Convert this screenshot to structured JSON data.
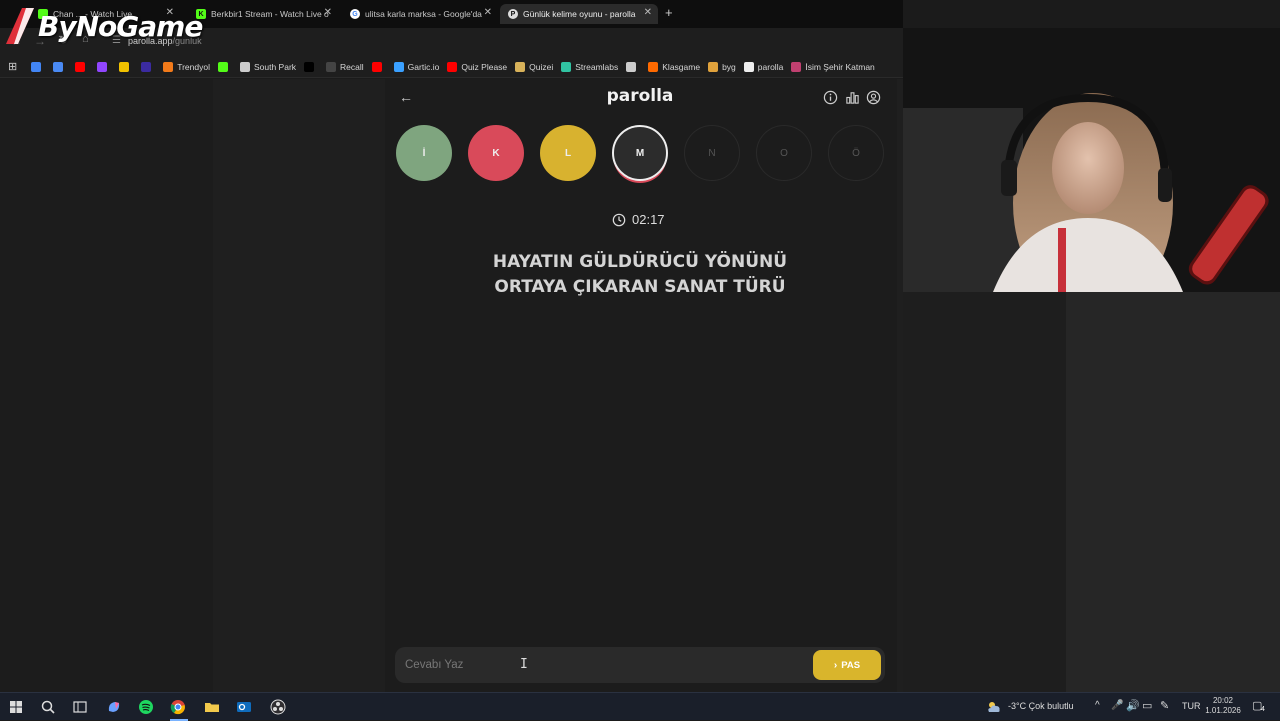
{
  "browser": {
    "tabs": [
      {
        "label": "Chan ... - Watch Live",
        "favicon_color": "#53fc18",
        "active": false
      },
      {
        "label": "Berkbir1 Stream - Watch Live o",
        "favicon_color": "#53fc18",
        "active": false
      },
      {
        "label": "ulitsa karla marksa - Google'da",
        "favicon_color": "#ffffff",
        "active": false
      },
      {
        "label": "Günlük kelime oyunu - parolla",
        "favicon_color": "#dddddd",
        "active": true
      }
    ],
    "new_tab": "+",
    "url_host": "parolla.app",
    "url_path": "/gunluk",
    "bookmarks": [
      {
        "label": "",
        "icon": "google-icon",
        "color": "#4285f4"
      },
      {
        "label": "",
        "icon": "translate-icon",
        "color": "#4a8af4"
      },
      {
        "label": "",
        "icon": "youtube-icon",
        "color": "#ff0000"
      },
      {
        "label": "",
        "icon": "twitch-icon",
        "color": "#9146ff"
      },
      {
        "label": "",
        "icon": "folder-icon",
        "color": "#f2c200"
      },
      {
        "label": "",
        "icon": "app-icon",
        "color": "#3b2ba0"
      },
      {
        "label": "Trendyol",
        "icon": "trendyol-icon",
        "color": "#f27a1a"
      },
      {
        "label": "",
        "icon": "kick-icon",
        "color": "#53fc18"
      },
      {
        "label": "South Park",
        "icon": "globe-icon",
        "color": "#cccccc"
      },
      {
        "label": "",
        "icon": "x-icon",
        "color": "#000000"
      },
      {
        "label": "Recall",
        "icon": "recall-icon",
        "color": "#444444"
      },
      {
        "label": "",
        "icon": "youtube-icon",
        "color": "#ff0000"
      },
      {
        "label": "Gartic.io",
        "icon": "gartic-icon",
        "color": "#3aa0ff"
      },
      {
        "label": "Quiz Please",
        "icon": "youtube-icon",
        "color": "#ff0000"
      },
      {
        "label": "Quizei",
        "icon": "quizei-icon",
        "color": "#d8b25a"
      },
      {
        "label": "Streamlabs",
        "icon": "streamlabs-icon",
        "color": "#31c3a2"
      },
      {
        "label": "",
        "icon": "globe-icon",
        "color": "#cccccc"
      },
      {
        "label": "Klasgame",
        "icon": "klasgame-icon",
        "color": "#ff6a00"
      },
      {
        "label": "byg",
        "icon": "byg-icon",
        "color": "#e0a23c"
      },
      {
        "label": "parolla",
        "icon": "parolla-icon",
        "color": "#eeeeee"
      },
      {
        "label": "İsim Şehir Katman",
        "icon": "isim-icon",
        "color": "#c04070"
      }
    ]
  },
  "logo": {
    "text": "ByNoGame"
  },
  "app": {
    "title": "parolla",
    "letters": [
      {
        "char": "İ",
        "state": "correct",
        "bg": "#7fa57f",
        "fg": "#eeeeee"
      },
      {
        "char": "K",
        "state": "wrong",
        "bg": "#d94a5a",
        "fg": "#eeeeee"
      },
      {
        "char": "L",
        "state": "pass",
        "bg": "#d8b22f",
        "fg": "#eeeeee"
      },
      {
        "char": "M",
        "state": "current",
        "bg": "#2c2c2c",
        "fg": "#eeeeee"
      },
      {
        "char": "N",
        "state": "future",
        "bg": "",
        "fg": "#555555"
      },
      {
        "char": "O",
        "state": "future",
        "bg": "",
        "fg": "#555555"
      },
      {
        "char": "Ö",
        "state": "future",
        "bg": "",
        "fg": "#555555"
      }
    ],
    "timer": "02:17",
    "question_line1": "HAYATIN GÜLDÜRÜCÜ YÖNÜNÜ",
    "question_line2": "ORTAYA ÇIKARAN SANAT TÜRÜ",
    "answer_placeholder": "Cevabı Yaz",
    "answer_value": "",
    "pass_label": "PAS",
    "accent": "#d9b52c"
  },
  "taskbar": {
    "weather": "-3°C  Çok bulutlu",
    "lang": "TUR",
    "time": "20:02",
    "date": "1.01.2026",
    "notifications": "4"
  }
}
